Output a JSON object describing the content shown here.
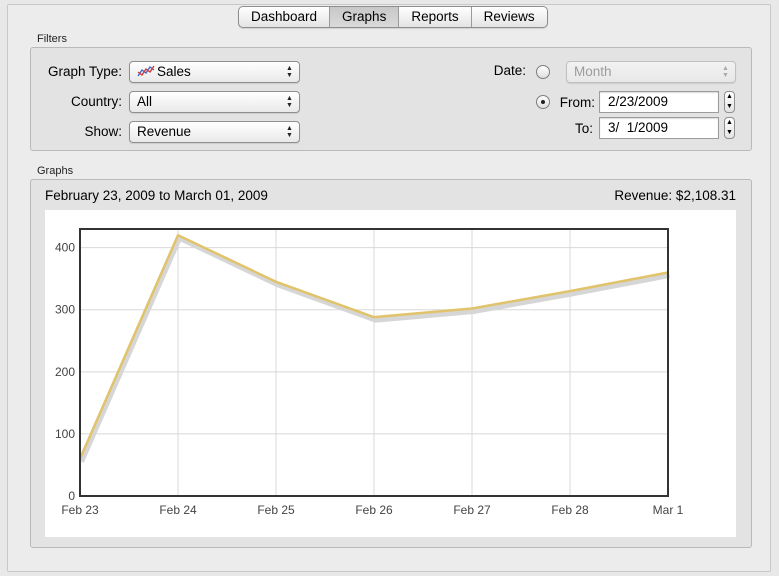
{
  "tabs": [
    {
      "label": "Dashboard",
      "active": false
    },
    {
      "label": "Graphs",
      "active": true
    },
    {
      "label": "Reports",
      "active": false
    },
    {
      "label": "Reviews",
      "active": false
    }
  ],
  "filters": {
    "group_label": "Filters",
    "graph_type": {
      "label": "Graph Type:",
      "value": "Sales",
      "icon": "sales-line-icon"
    },
    "country": {
      "label": "Country:",
      "value": "All"
    },
    "show": {
      "label": "Show:",
      "value": "Revenue"
    },
    "date": {
      "label": "Date:",
      "month_value": "Month",
      "month_selected": false
    },
    "from": {
      "label": "From:",
      "value": "2/23/2009",
      "selected": true
    },
    "to": {
      "label": "To:",
      "value": "3/  1/2009"
    }
  },
  "graphs": {
    "group_label": "Graphs",
    "date_range": "February 23, 2009 to March 01, 2009",
    "total": "Revenue: $2,108.31"
  },
  "colors": {
    "line": "#e0c36a",
    "shadow": "#d6d6d6",
    "grid": "#d8d8d8",
    "frame": "#333333"
  },
  "chart_data": {
    "type": "line",
    "categories": [
      "Feb 23",
      "Feb 24",
      "Feb 25",
      "Feb 26",
      "Feb 27",
      "Feb 28",
      "Mar 1"
    ],
    "series": [
      {
        "values": [
          60,
          420,
          345,
          288,
          302,
          330,
          360
        ]
      }
    ],
    "yticks": [
      "0",
      "100",
      "200",
      "300",
      "400"
    ],
    "ylim": [
      0,
      430
    ],
    "grid": true
  }
}
